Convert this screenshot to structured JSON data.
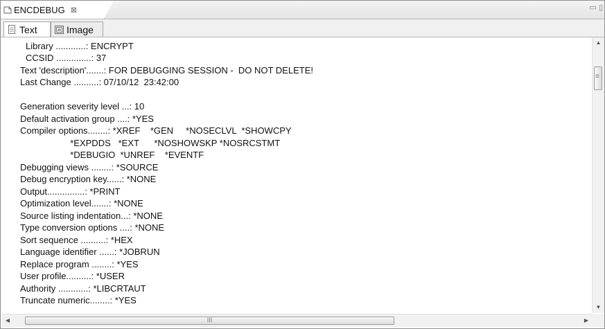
{
  "view_tab": {
    "title": "ENCDEBUG",
    "close_glyph": "⊠",
    "file_icon": "file-icon"
  },
  "window_controls": {
    "minimize_glyph": "▭",
    "restore_glyph": "▯"
  },
  "subtabs": [
    {
      "label": "Text",
      "icon": "text-page-icon",
      "selected": true
    },
    {
      "label": "Image",
      "icon": "image-icon",
      "selected": false
    }
  ],
  "content_lines": [
    "Library ............: ENCRYPT",
    "CCSID ..............: 37",
    "Text 'description'.......: FOR DEBUGGING SESSION -  DO NOT DELETE!",
    "Last Change ..........: 07/10/12  23:42:00",
    "",
    "Generation severity level ...: 10",
    "Default activation group ....: *YES",
    "Compiler options........: *XREF    *GEN     *NOSECLVL  *SHOWCPY",
    "                    *EXPDDS   *EXT      *NOSHOWSKP *NOSRCSTMT",
    "                    *DEBUGIO  *UNREF    *EVENTF",
    "Debugging views ........: *SOURCE",
    "Debug encryption key......: *NONE",
    "Output...............: *PRINT",
    "Optimization level.......: *NONE",
    "Source listing indentation...: *NONE",
    "Type conversion options ....: *NONE",
    "Sort sequence ..........: *HEX",
    "Language identifier ......: *JOBRUN",
    "Replace program ........: *YES",
    "User profile..........: *USER",
    "Authority ............: *LIBCRTAUT",
    "Truncate numeric........: *YES"
  ],
  "scrollbar": {
    "up_glyph": "▲",
    "down_glyph": "▼",
    "left_glyph": "◀",
    "right_glyph": "▶",
    "grip_glyph": "III"
  },
  "colors": {
    "frame_border": "#8e8e8e",
    "tab_bg": "#ffffff",
    "bar_bg": "#f0f0f0"
  }
}
